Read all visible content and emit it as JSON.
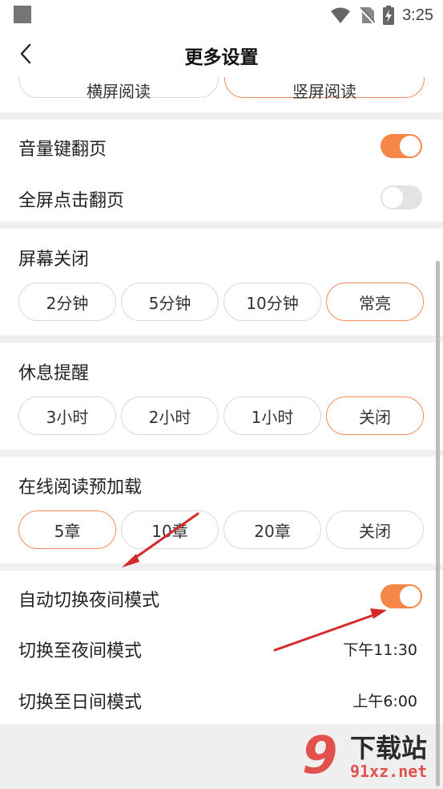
{
  "status_bar": {
    "time": "3:25"
  },
  "header": {
    "title": "更多设置"
  },
  "orientation": {
    "options": [
      {
        "label": "横屏阅读",
        "active": false
      },
      {
        "label": "竖屏阅读",
        "active": true
      }
    ]
  },
  "page_turn": {
    "volume_key": {
      "label": "音量键翻页",
      "on": true
    },
    "fullscreen_tap": {
      "label": "全屏点击翻页",
      "on": false
    }
  },
  "screen_off": {
    "title": "屏幕关闭",
    "options": [
      {
        "label": "2分钟",
        "active": false
      },
      {
        "label": "5分钟",
        "active": false
      },
      {
        "label": "10分钟",
        "active": false
      },
      {
        "label": "常亮",
        "active": true
      }
    ]
  },
  "rest_reminder": {
    "title": "休息提醒",
    "options": [
      {
        "label": "3小时",
        "active": false
      },
      {
        "label": "2小时",
        "active": false
      },
      {
        "label": "1小时",
        "active": false
      },
      {
        "label": "关闭",
        "active": true
      }
    ]
  },
  "preload": {
    "title": "在线阅读预加载",
    "options": [
      {
        "label": "5章",
        "active": true
      },
      {
        "label": "10章",
        "active": false
      },
      {
        "label": "20章",
        "active": false
      },
      {
        "label": "关闭",
        "active": false
      }
    ]
  },
  "night_mode": {
    "auto_switch": {
      "label": "自动切换夜间模式",
      "on": true
    },
    "to_night": {
      "label": "切换至夜间模式",
      "value": "下午11:30"
    },
    "to_day": {
      "label": "切换至日间模式",
      "value": "上午6:00"
    }
  },
  "watermark": {
    "digit": "9",
    "text": "下载站",
    "domain": "91xz.net"
  },
  "colors": {
    "accent": "#f58748",
    "arrow": "#d42a2a",
    "watermark": "#e1524e"
  }
}
